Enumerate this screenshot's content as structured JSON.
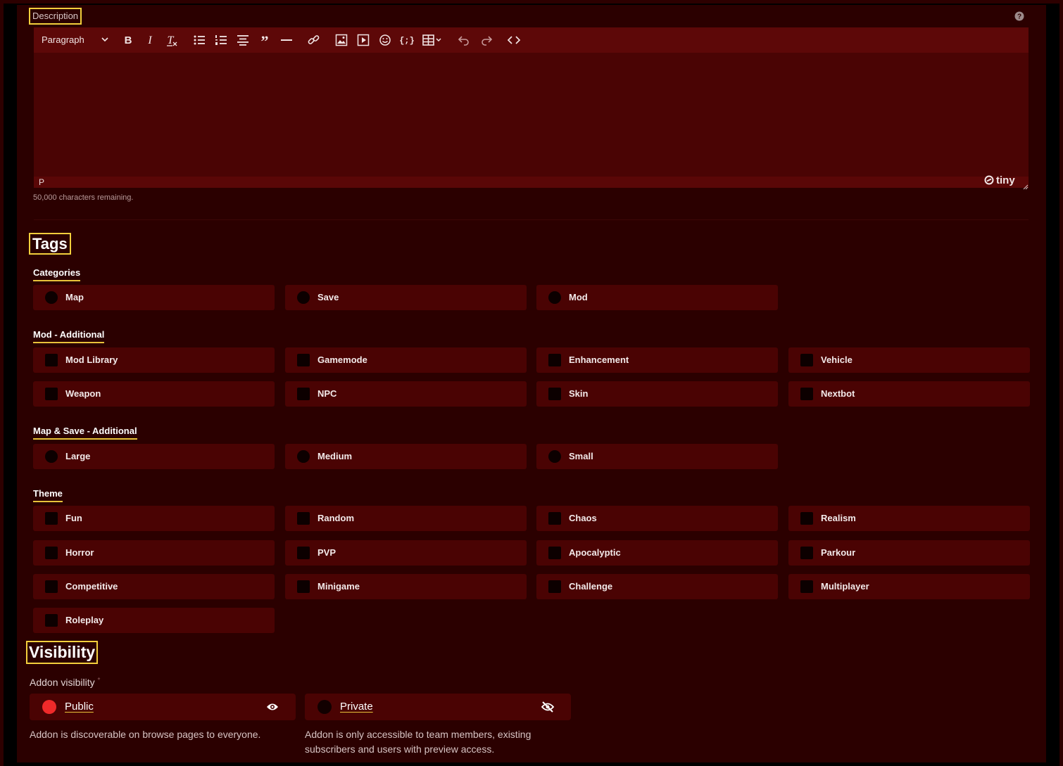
{
  "description": {
    "label": "Description",
    "toolbar": {
      "block_format": "Paragraph",
      "buttons": [
        "bold",
        "italic",
        "clear-formatting",
        "bullet-list",
        "numbered-list",
        "align-center",
        "blockquote",
        "horizontal-rule",
        "link",
        "image",
        "media",
        "emoji",
        "code-sample",
        "table",
        "undo",
        "redo",
        "source-code"
      ]
    },
    "status_path": "P",
    "brand": "tiny",
    "chars_remaining": "50,000 characters remaining."
  },
  "tags": {
    "title": "Tags",
    "groups": [
      {
        "label": "Categories",
        "items": [
          "Map",
          "Save",
          "Mod"
        ]
      },
      {
        "label": "Mod - Additional",
        "items": [
          "Mod Library",
          "Gamemode",
          "Enhancement",
          "Vehicle",
          "Weapon",
          "NPC",
          "Skin",
          "Nextbot"
        ]
      },
      {
        "label": "Map & Save - Additional",
        "items": [
          "Large",
          "Medium",
          "Small"
        ]
      },
      {
        "label": "Theme",
        "items": [
          "Fun",
          "Random",
          "Chaos",
          "Realism",
          "Horror",
          "PVP",
          "Apocalyptic",
          "Parkour",
          "Competitive",
          "Minigame",
          "Challenge",
          "Multiplayer",
          "Roleplay"
        ]
      }
    ]
  },
  "visibility": {
    "title": "Visibility",
    "label": "Addon visibility",
    "required_mark": "*",
    "options": [
      {
        "label": "Public",
        "selected": true,
        "icon": "eye-icon",
        "description": "Addon is discoverable on browse pages to everyone."
      },
      {
        "label": "Private",
        "selected": false,
        "icon": "eye-off-icon",
        "description": "Addon is only accessible to team members, existing subscribers and users with preview access."
      }
    ]
  },
  "colors": {
    "background": "#2b0000",
    "tag_background": "#4a0303",
    "toolbar": "#5d0808",
    "accent": "#e8c33a",
    "selected": "#ef2a2a"
  }
}
